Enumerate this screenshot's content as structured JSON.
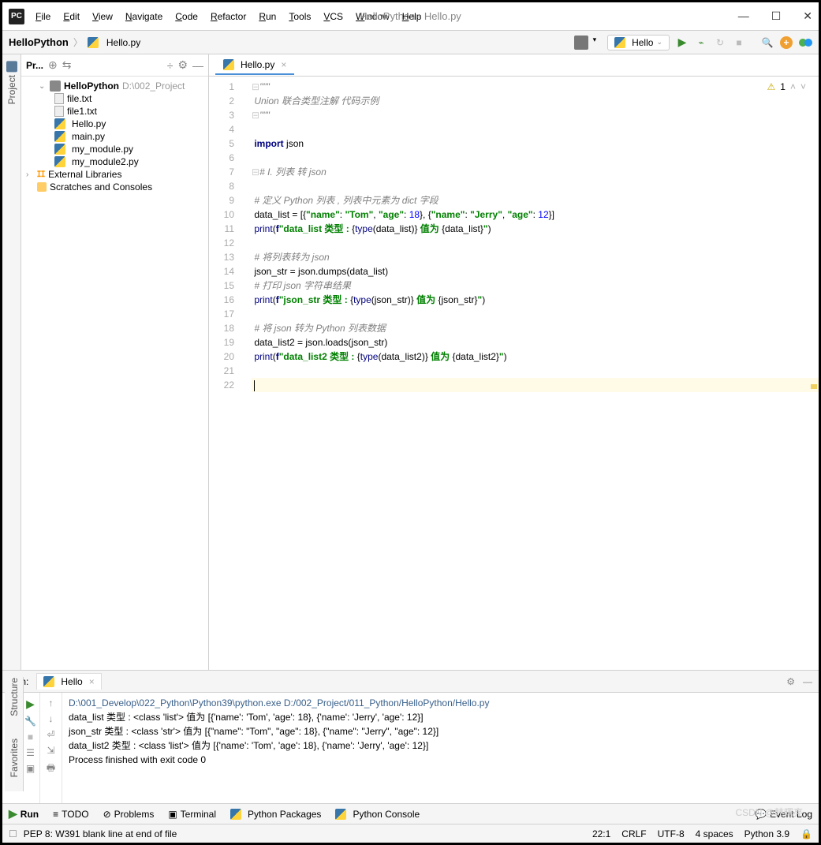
{
  "window": {
    "title": "HelloPython - Hello.py"
  },
  "menu": [
    "File",
    "Edit",
    "View",
    "Navigate",
    "Code",
    "Refactor",
    "Run",
    "Tools",
    "VCS",
    "Window",
    "Help"
  ],
  "breadcrumb": {
    "project": "HelloPython",
    "file": "Hello.py"
  },
  "run_config": "Hello",
  "project_panel": {
    "title": "Pr...",
    "root": {
      "name": "HelloPython",
      "path": "D:\\002_Project"
    },
    "files": [
      "file.txt",
      "file1.txt",
      "Hello.py",
      "main.py",
      "my_module.py",
      "my_module2.py"
    ],
    "external": "External Libraries",
    "scratches": "Scratches and Consoles"
  },
  "editor": {
    "tab": "Hello.py",
    "problems_badge": "1",
    "lines": [
      {
        "n": 1,
        "type": "cmt",
        "text": "\"\"\"",
        "fold": true
      },
      {
        "n": 2,
        "type": "cmt",
        "text": "Union 联合类型注解 代码示例"
      },
      {
        "n": 3,
        "type": "cmt",
        "text": "\"\"\"",
        "fold": true
      },
      {
        "n": 4,
        "type": "blank",
        "text": ""
      },
      {
        "n": 5,
        "type": "code",
        "html": "<span class='c-kw'>import</span> json"
      },
      {
        "n": 6,
        "type": "blank",
        "text": ""
      },
      {
        "n": 7,
        "type": "cmt",
        "text": "# I. 列表 转 json",
        "fold": true
      },
      {
        "n": 8,
        "type": "blank",
        "text": ""
      },
      {
        "n": 9,
        "type": "cmt",
        "text": "# 定义 Python 列表 , 列表中元素为 dict 字段"
      },
      {
        "n": 10,
        "type": "code",
        "html": "data_list = [{<span class='c-str'>\"name\"</span>: <span class='c-str'>\"Tom\"</span>, <span class='c-str'>\"age\"</span>: <span class='c-num'>18</span>}, {<span class='c-str'>\"name\"</span>: <span class='c-str'>\"Jerry\"</span>, <span class='c-str'>\"age\"</span>: <span class='c-num'>12</span>}]"
      },
      {
        "n": 11,
        "type": "code",
        "html": "<span class='c-bi'>print</span>(<span class='c-kw'>f</span><span class='c-str'>\"data_list 类型 : </span>{<span class='c-bi'>type</span>(data_list)}<span class='c-str'> 值为 </span>{data_list}<span class='c-str'>\"</span>)"
      },
      {
        "n": 12,
        "type": "blank",
        "text": ""
      },
      {
        "n": 13,
        "type": "cmt",
        "text": "# 将列表转为 json"
      },
      {
        "n": 14,
        "type": "code",
        "html": "json_str = json.dumps(data_list)"
      },
      {
        "n": 15,
        "type": "cmt",
        "text": "# 打印 json 字符串结果"
      },
      {
        "n": 16,
        "type": "code",
        "html": "<span class='c-bi'>print</span>(<span class='c-kw'>f</span><span class='c-str'>\"json_str 类型 : </span>{<span class='c-bi'>type</span>(json_str)}<span class='c-str'> 值为 </span>{json_str}<span class='c-str'>\"</span>)"
      },
      {
        "n": 17,
        "type": "blank",
        "text": ""
      },
      {
        "n": 18,
        "type": "cmt",
        "text": "# 将 json 转为 Python 列表数据"
      },
      {
        "n": 19,
        "type": "code",
        "html": "data_list2 = json.loads(json_str)"
      },
      {
        "n": 20,
        "type": "code",
        "html": "<span class='c-bi'>print</span>(<span class='c-kw'>f</span><span class='c-str'>\"data_list2 类型 : </span>{<span class='c-bi'>type</span>(data_list2)}<span class='c-str'> 值为 </span>{data_list2}<span class='c-str'>\"</span>)"
      },
      {
        "n": 21,
        "type": "blank",
        "text": ""
      },
      {
        "n": 22,
        "type": "caret",
        "text": ""
      }
    ]
  },
  "run_panel": {
    "title": "Run:",
    "tab": "Hello",
    "output": [
      {
        "cls": "path",
        "text": "D:\\001_Develop\\022_Python\\Python39\\python.exe D:/002_Project/011_Python/HelloPython/Hello.py"
      },
      {
        "cls": "",
        "text": "data_list 类型 : <class 'list'> 值为 [{'name': 'Tom', 'age': 18}, {'name': 'Jerry', 'age': 12}]"
      },
      {
        "cls": "",
        "text": "json_str 类型 : <class 'str'> 值为 [{\"name\": \"Tom\", \"age\": 18}, {\"name\": \"Jerry\", \"age\": 12}]"
      },
      {
        "cls": "",
        "text": "data_list2 类型 : <class 'list'> 值为 [{'name': 'Tom', 'age': 18}, {'name': 'Jerry', 'age': 12}]"
      },
      {
        "cls": "",
        "text": ""
      },
      {
        "cls": "",
        "text": "Process finished with exit code 0"
      }
    ]
  },
  "bottom_tools": {
    "run": "Run",
    "todo": "TODO",
    "problems": "Problems",
    "terminal": "Terminal",
    "pkgs": "Python Packages",
    "console": "Python Console",
    "log": "Event Log"
  },
  "status": {
    "msg": "PEP 8: W391 blank line at end of file",
    "pos": "22:1",
    "sep": "CRLF",
    "enc": "UTF-8",
    "indent": "4 spaces",
    "interp": "Python 3.9"
  },
  "side_left": {
    "project": "Project",
    "structure": "Structure",
    "favorites": "Favorites"
  },
  "watermark": "CSDN @韩曙亮"
}
